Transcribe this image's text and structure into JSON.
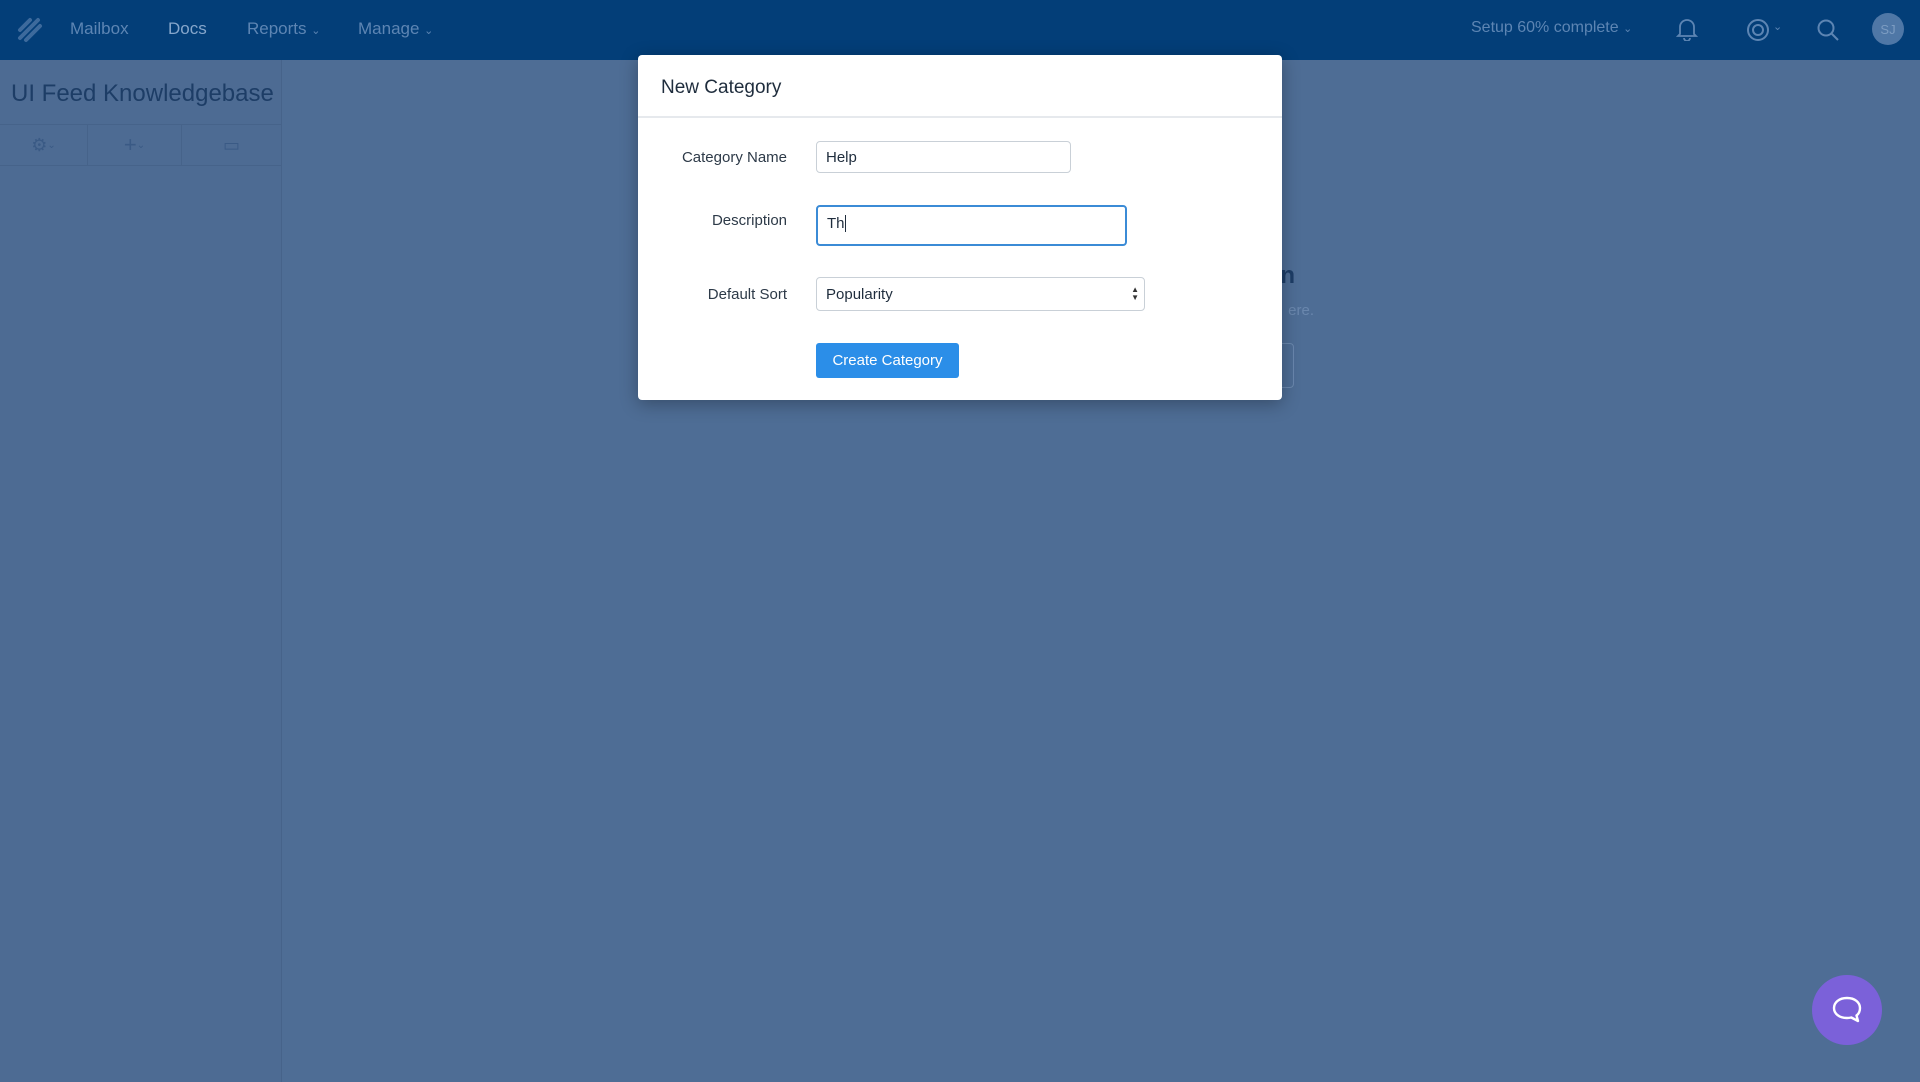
{
  "nav": {
    "items": [
      "Mailbox",
      "Docs",
      "Reports",
      "Manage"
    ],
    "setup": "Setup 60% complete",
    "avatar": "SJ"
  },
  "sidebar": {
    "title": "UI Feed Knowledgebase"
  },
  "background": {
    "heading_fragment": "n",
    "text_fragment": "ere."
  },
  "modal": {
    "title": "New Category",
    "name_label": "Category Name",
    "name_value": "Help",
    "description_label": "Description",
    "description_value": "Th",
    "sort_label": "Default Sort",
    "sort_value": "Popularity",
    "submit": "Create Category"
  },
  "colors": {
    "nav": "#1f5d9b",
    "primary": "#2b8ee8",
    "chat": "#7b61d9"
  }
}
